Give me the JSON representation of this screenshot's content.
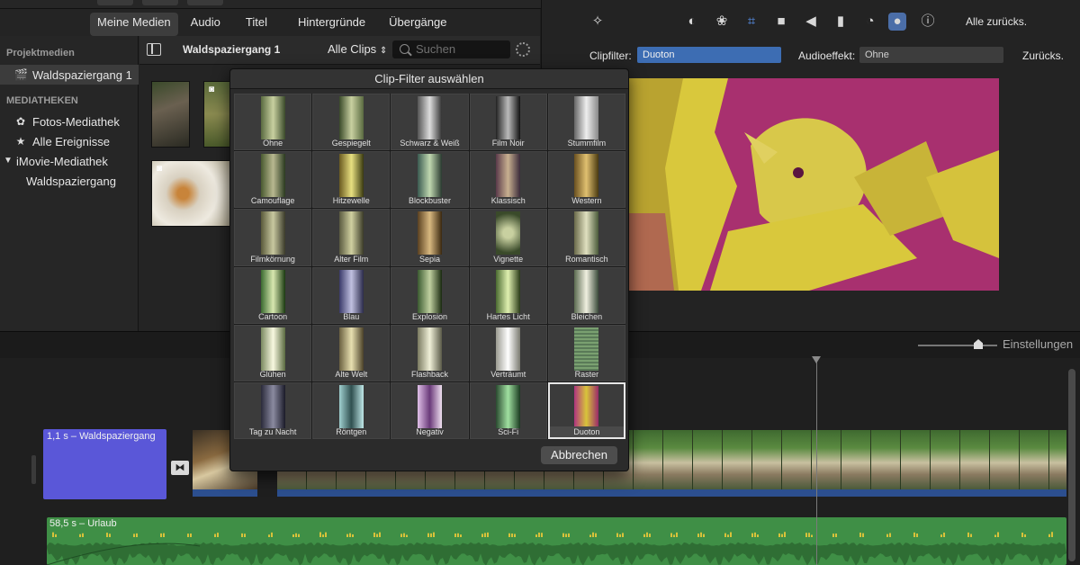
{
  "tabs": [
    "Meine Medien",
    "Audio",
    "Titel",
    "Hintergründe",
    "Übergänge"
  ],
  "sidebar": {
    "project_header": "Projektmedien",
    "project_item": "Waldspaziergang 1",
    "libraries_header": "MEDIATHEKEN",
    "items": [
      "Fotos-Mediathek",
      "Alle Ereignisse",
      "iMovie-Mediathek",
      "Waldspaziergang"
    ]
  },
  "browser": {
    "event_title": "Waldspaziergang 1",
    "filter_dropdown": "Alle Clips",
    "search_placeholder": "Suchen"
  },
  "inspector": {
    "reset_all": "Alle zurücks.",
    "clipfilter_label": "Clipfilter:",
    "clipfilter_value": "Duoton",
    "audioeffect_label": "Audioeffekt:",
    "audioeffect_value": "Ohne",
    "reset": "Zurücks.",
    "tools": [
      "magic-wand-icon",
      "color-balance-icon",
      "color-palette-icon",
      "crop-icon",
      "camera-icon",
      "volume-icon",
      "equalizer-icon",
      "speed-icon",
      "filter-icon",
      "info-icon"
    ]
  },
  "modal": {
    "title": "Clip-Filter auswählen",
    "filters": [
      "Ohne",
      "Gespiegelt",
      "Schwarz & Weiß",
      "Film Noir",
      "Stummfilm",
      "Camouflage",
      "Hitzewelle",
      "Blockbuster",
      "Klassisch",
      "Western",
      "Filmkörnung",
      "Alter Film",
      "Sepia",
      "Vignette",
      "Romantisch",
      "Cartoon",
      "Blau",
      "Explosion",
      "Hartes Licht",
      "Bleichen",
      "Glühen",
      "Alte Welt",
      "Flashback",
      "Verträumt",
      "Raster",
      "Tag zu Nacht",
      "Röntgen",
      "Negativ",
      "Sci-Fi",
      "Duoton"
    ],
    "selected": "Duoton",
    "cancel_label": "Abbrechen"
  },
  "timeline": {
    "settings_label": "Einstellungen",
    "title_clip_label": "1,1 s – Waldspaziergang",
    "audio_clip_label": "58,5 s – Urlaub"
  },
  "colors": {
    "accent": "#4b6ea8",
    "title_clip": "#5a57d8",
    "audio_clip": "#3f8f46",
    "duoton_a": "#d8c53a",
    "duoton_b": "#b0347f"
  }
}
